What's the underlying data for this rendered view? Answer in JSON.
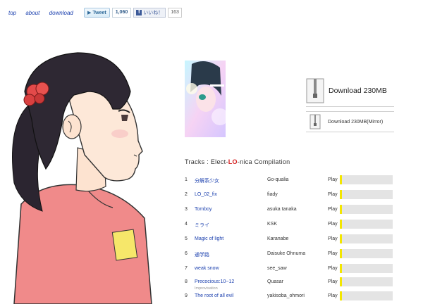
{
  "nav": {
    "links": [
      "top",
      "about",
      "download"
    ]
  },
  "social": {
    "tweet_label": "Tweet",
    "tweet_count": "1,060",
    "like_label": "いいね！",
    "like_count": "163"
  },
  "download": {
    "main_label": "Download 230MB",
    "mirror_label": "Download 230MB(Mirror)"
  },
  "tracks": {
    "title_prefix": "Tracks : Elect-",
    "title_highlight": "LO",
    "title_suffix": "-nica Compilation",
    "play_label": "Play",
    "items": [
      {
        "num": "1",
        "name": "分解系少女",
        "artist": "Go-qualia"
      },
      {
        "num": "2",
        "name": "LO_02_fix",
        "artist": "fiady"
      },
      {
        "num": "3",
        "name": "Tomboy",
        "artist": "asuka tanaka"
      },
      {
        "num": "4",
        "name": "ミライ",
        "artist": "KSK"
      },
      {
        "num": "5",
        "name": "Magic of light",
        "artist": "Karanabe"
      },
      {
        "num": "6",
        "name": "通学路",
        "artist": "Daisuke Ohnuma"
      },
      {
        "num": "7",
        "name": "weak snow",
        "artist": "see_saw"
      },
      {
        "num": "8",
        "name": "Precocious:10~12",
        "sub": "Improvisation",
        "artist": "Quasar"
      },
      {
        "num": "9",
        "name": "The root of all evil",
        "artist": "yakisoba_ohmori"
      }
    ]
  },
  "colors": {
    "link": "#1a3fae",
    "accent": "#d42020",
    "play_marker": "#f3e600"
  }
}
